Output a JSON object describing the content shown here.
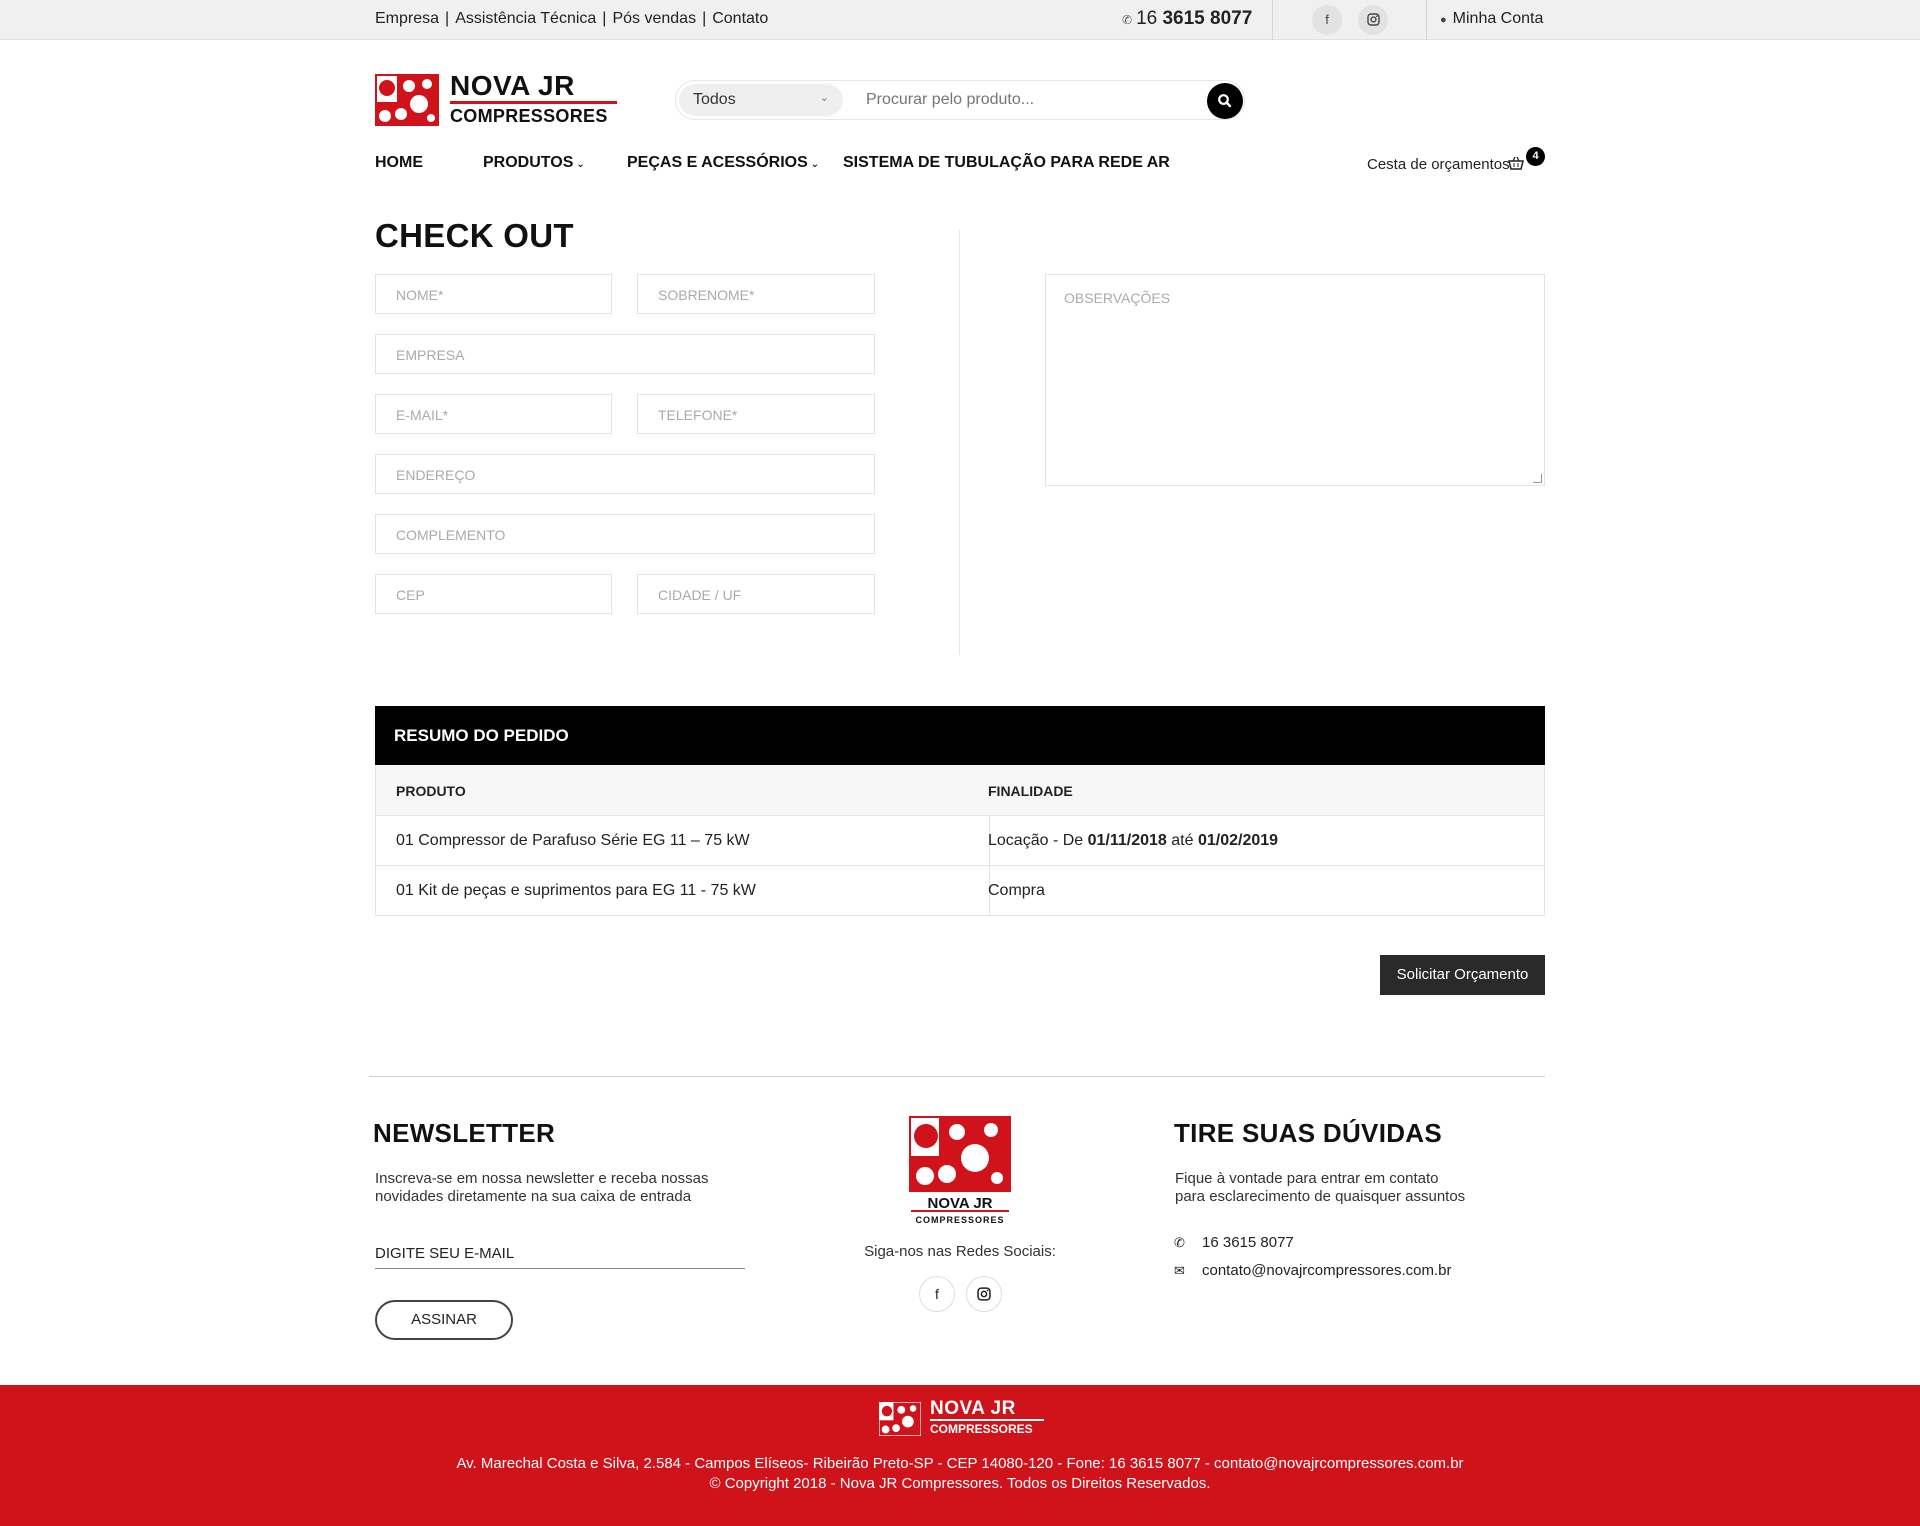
{
  "topbar": {
    "links": [
      "Empresa",
      "Assistência Técnica",
      "Pós vendas",
      "Contato"
    ],
    "separator": "|",
    "phone_prefix": "16",
    "phone_number": "3615 8077",
    "social": [
      "facebook-icon",
      "instagram-icon"
    ],
    "account_label": "Minha Conta"
  },
  "brand": {
    "name_line1": "NOVA JR",
    "name_line2": "COMPRESSORES",
    "accent_color": "#d0121b"
  },
  "search": {
    "category": "Todos",
    "placeholder": "Procurar pelo produto..."
  },
  "nav": {
    "items": [
      "HOME",
      "PRODUTOS",
      "PEÇAS E ACESSÓRIOS",
      "SISTEMA DE TUBULAÇÃO PARA REDE AR"
    ],
    "cart_label": "Cesta de orçamentos",
    "cart_count": "4"
  },
  "checkout": {
    "title": "CHECK OUT",
    "fields": {
      "nome": "NOME*",
      "sobrenome": "SOBRENOME*",
      "empresa": "EMPRESA",
      "email": "E-MAIL*",
      "telefone": "TELEFONE*",
      "endereco": "ENDEREÇO",
      "complemento": "COMPLEMENTO",
      "cep": "CEP",
      "cidade": "CIDADE / UF",
      "observacoes": "OBSERVAÇÕES"
    }
  },
  "summary": {
    "title": "RESUMO DO PEDIDO",
    "col_product": "PRODUTO",
    "col_purpose": "FINALIDADE",
    "rows": [
      {
        "product": "01 Compressor de Parafuso Série EG 11 – 75 kW",
        "purpose_prefix": "Locação - De ",
        "date_from": "01/11/2018",
        "purpose_mid": " até ",
        "date_to": "01/02/2019"
      },
      {
        "product": "01 Kit de peças e suprimentos para EG 11 - 75 kW",
        "purpose": "Compra"
      }
    ],
    "submit_label": "Solicitar Orçamento"
  },
  "footer": {
    "newsletter_title": "NEWSLETTER",
    "newsletter_text_1": "Inscreva-se em nossa newsletter e receba nossas",
    "newsletter_text_2": "novidades diretamente na sua caixa de entrada",
    "newsletter_value": "DIGITE SEU E-MAIL",
    "subscribe_label": "ASSINAR",
    "follow_text": "Siga-nos nas Redes Sociais:",
    "help_title": "TIRE SUAS DÚVIDAS",
    "help_text_1": "Fique à vontade para entrar em contato",
    "help_text_2": "para esclarecimento de quaisquer assuntos",
    "phone": "16 3615 8077",
    "email": "contato@novajrcompressores.com.br",
    "address": "Av. Marechal Costa e Silva, 2.584 - Campos Elíseos- Ribeirão Preto-SP - CEP 14080-120 - Fone: 16 3615 8077 - contato@novajrcompressores.com.br",
    "copyright": "© Copyright 2018 - Nova JR Compressores. Todos os Direitos Reservados."
  }
}
